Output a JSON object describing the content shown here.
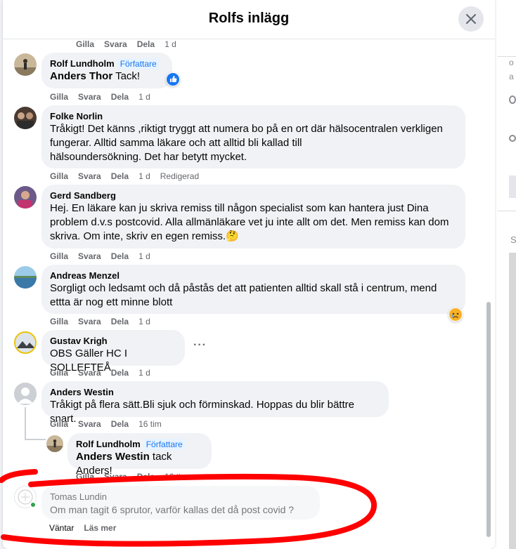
{
  "modal": {
    "title": "Rolfs inlägg"
  },
  "top_actions": {
    "like": "Gilla",
    "reply": "Svara",
    "share": "Dela",
    "time": "1 d"
  },
  "comments": [
    {
      "name": "Rolf Lundholm",
      "badge": "Författare",
      "mention": "Anders Thor",
      "text": " Tack!",
      "like": "Gilla",
      "reply": "Svara",
      "share": "Dela",
      "time": "1 d",
      "reaction": "like-reaction"
    },
    {
      "name": "Folke Norlin",
      "lines": [
        "Tråkigt! Det känns ,riktigt tryggt att numera bo på en ort där hälsocentralen verkligen",
        "fungerar. Alltid samma läkare och att alltid bli kallad till",
        "hälsoundersökning. Det har betytt mycket."
      ],
      "like": "Gilla",
      "reply": "Svara",
      "share": "Dela",
      "time": "1 d",
      "edited": "Redigerad"
    },
    {
      "name": "Gerd Sandberg",
      "lines": [
        "Hej. En läkare kan ju skriva remiss till någon specialist som kan hantera just Dina",
        "problem d.v.s postcovid. Alla allmänläkare vet ju inte allt om det. Men remiss kan dom",
        "skriva. Om inte, skriv en egen remiss.🤔"
      ],
      "like": "Gilla",
      "reply": "Svara",
      "share": "Dela",
      "time": "1 d"
    },
    {
      "name": "Andreas Menzel",
      "lines": [
        "Sorgligt och ledsamt och då påstås det att patienten alltid skall stå i centrum, mend",
        "ettta är nog ett minne blott"
      ],
      "like": "Gilla",
      "reply": "Svara",
      "share": "Dela",
      "time": "1 d",
      "reaction": "sad-reaction"
    },
    {
      "name": "Gustav Krigh",
      "text": "OBS Gäller HC I SOLLEFTEÅ",
      "like": "Gilla",
      "reply": "Svara",
      "share": "Dela",
      "time": "1 d"
    },
    {
      "name": "Anders Westin",
      "text": "Tråkigt på flera sätt.Bli sjuk och förminskad. Hoppas du blir bättre snart.",
      "like": "Gilla",
      "reply": "Svara",
      "share": "Dela",
      "time": "16 tim"
    },
    {
      "name": "Rolf Lundholm",
      "badge": "Författare",
      "mention": "Anders Westin",
      "text": " tack Anders!",
      "like": "Gilla",
      "reply": "Svara",
      "share": "Dela",
      "time": "16 tim"
    }
  ],
  "pending_comment": {
    "name": "Tomas Lundin",
    "text": "Om man tagit 6 sprutor, varför kallas det då post covid ?",
    "status": "Väntar",
    "read_more": "Läs mer"
  },
  "colors": {
    "accent": "#1877f2",
    "bubble": "#f0f2f5",
    "annotation": "#ff0000"
  }
}
